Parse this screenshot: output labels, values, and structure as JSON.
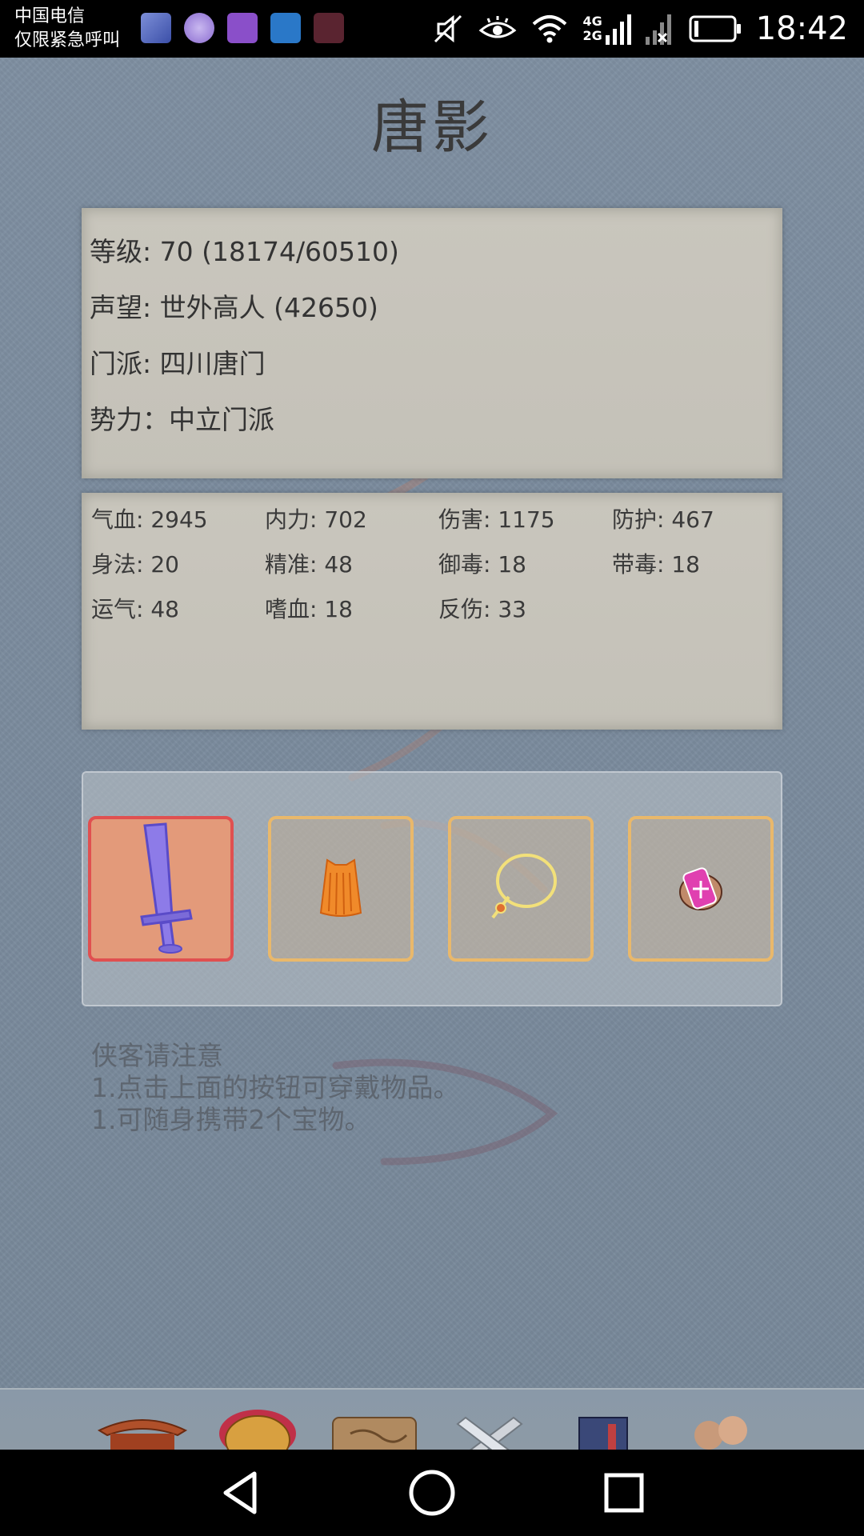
{
  "status_bar": {
    "carrier_line1": "中国电信",
    "carrier_line2": "仅限紧急呼叫",
    "network_4g": "4G",
    "network_2g": "2G",
    "time": "18:42",
    "notification_icons": [
      "game-app-icon",
      "moon-app-icon",
      "gallery-app-icon",
      "phone-manager-icon",
      "video-app-icon"
    ]
  },
  "page": {
    "title": "唐影"
  },
  "info": {
    "level": "等级: 70 (18174/60510)",
    "reputation": "声望: 世外高人 (42650)",
    "sect": "门派: 四川唐门",
    "faction": "势力：中立门派"
  },
  "stats": [
    "气血: 2945",
    "内力: 702",
    "伤害: 1175",
    "防护: 467",
    "身法: 20",
    "精准: 48",
    "御毒: 18",
    "带毒: 18",
    "运气: 48",
    "嗜血: 18",
    "反伤: 33"
  ],
  "equipment": {
    "slots": [
      "sword-icon",
      "robe-icon",
      "necklace-icon",
      "talisman-icon"
    ],
    "active_slot": 0
  },
  "notice": {
    "heading": "侠客请注意",
    "line1": "1.点击上面的按钮可穿戴物品。",
    "line2": "1.可随身携带2个宝物。"
  },
  "bottom_nav": [
    "pavilion-icon",
    "armor-icon",
    "map-scroll-icon",
    "crossed-swords-icon",
    "book-icon",
    "people-icon"
  ],
  "colors": {
    "background": "#7e8fa1",
    "paper": "#c6c3ba",
    "slot_border": "#e9b86b",
    "active_slot_border": "#e05050"
  }
}
